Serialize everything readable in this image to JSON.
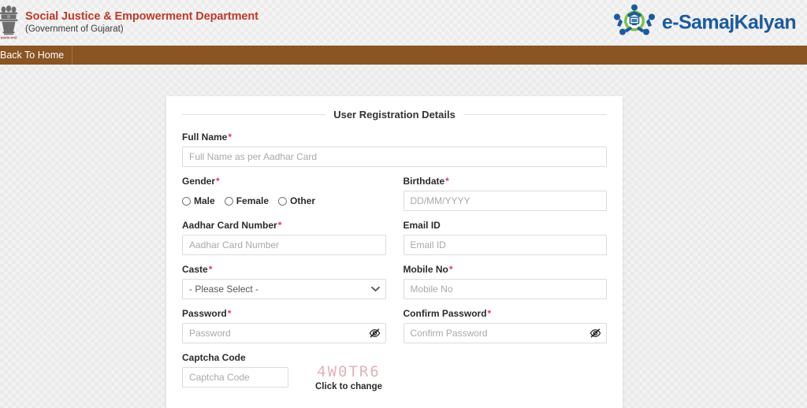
{
  "header": {
    "emblem_icon": "india-national-emblem-icon",
    "department_title": "Social Justice & Empowerment Department",
    "government_subtitle": "(Government of Gujarat)",
    "brand_logo_icon": "e-samajkalyan-logo-icon",
    "brand_name": "e-SamajKalyan",
    "brand_color": "#1b5a9e",
    "title_color": "#c0392b"
  },
  "navbar": {
    "background_color": "#8a5423",
    "back_to_home_label": "Back To Home"
  },
  "form": {
    "legend": "User Registration Details",
    "required_marker": "*",
    "fields": {
      "full_name": {
        "label": "Full Name",
        "placeholder": "Full Name as per Aadhar Card",
        "value": "",
        "required": true
      },
      "gender": {
        "label": "Gender",
        "required": true,
        "options": [
          "Male",
          "Female",
          "Other"
        ],
        "selected": ""
      },
      "birthdate": {
        "label": "Birthdate",
        "placeholder": "DD/MM/YYYY",
        "value": "",
        "required": true
      },
      "aadhar_card_number": {
        "label": "Aadhar Card Number",
        "placeholder": "Aadhar Card Number",
        "value": "",
        "required": true
      },
      "email_id": {
        "label": "Email ID",
        "placeholder": "Email ID",
        "value": "",
        "required": false
      },
      "caste": {
        "label": "Caste",
        "selected": "- Please Select -",
        "required": true,
        "dropdown_icon": "chevron-down-icon"
      },
      "mobile_no": {
        "label": "Mobile No",
        "placeholder": "Mobile No",
        "value": "",
        "required": true
      },
      "password": {
        "label": "Password",
        "placeholder": "Password",
        "value": "",
        "required": true,
        "toggle_icon": "eye-slash-icon"
      },
      "confirm_password": {
        "label": "Confirm Password",
        "placeholder": "Confirm Password",
        "value": "",
        "required": true,
        "toggle_icon": "eye-slash-icon"
      },
      "captcha_code": {
        "label": "Captcha Code",
        "placeholder": "Captcha Code",
        "value": "",
        "required": false,
        "captcha_text": "4W0TR6",
        "captcha_color": "#e0b4ba",
        "refresh_label": "Click to change"
      }
    }
  }
}
